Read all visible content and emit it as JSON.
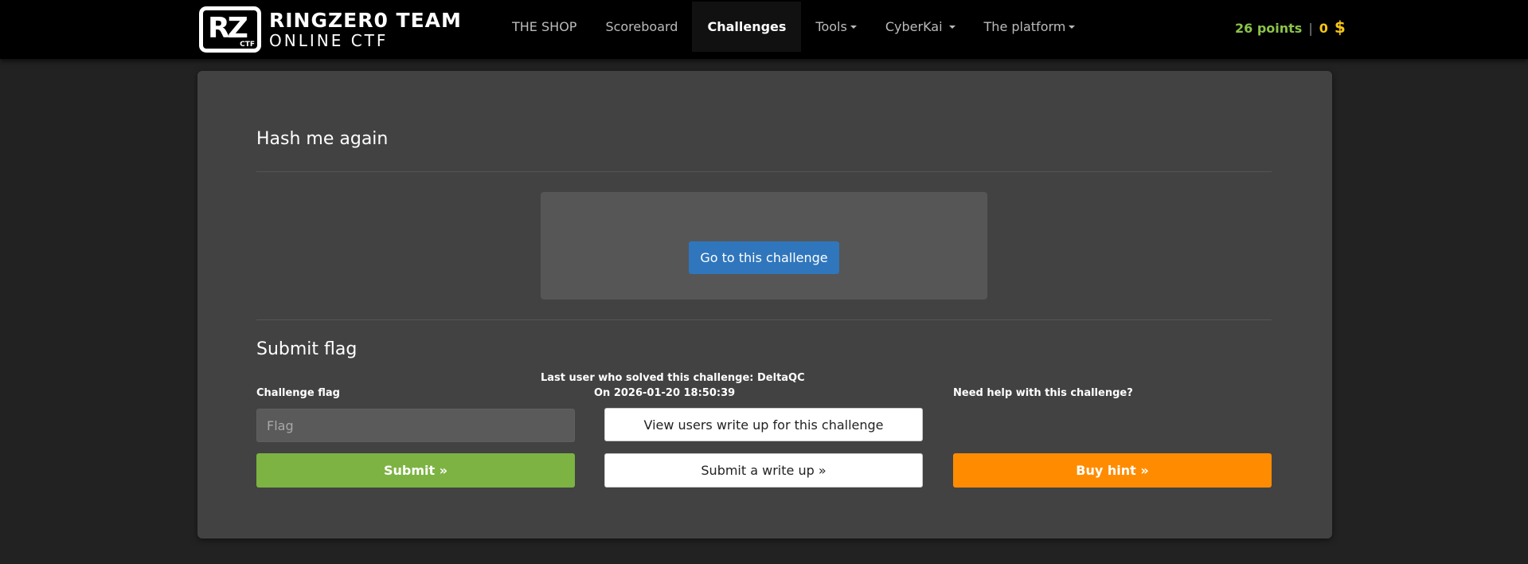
{
  "brand": {
    "logo_text": "RZ",
    "logo_sub": "CTF",
    "line1": "RINGZER0 TEAM",
    "line2": "ONLINE CTF"
  },
  "nav": {
    "shop": "THE SHOP",
    "scoreboard": "Scoreboard",
    "challenges": "Challenges",
    "tools": "Tools",
    "cyberkai": "CyberKai",
    "platform": "The platform"
  },
  "stats": {
    "points": "26 points",
    "separator": "|",
    "coins": "0",
    "currency": "$"
  },
  "challenge": {
    "title": "Hash me again",
    "go_button": "Go to this challenge"
  },
  "submit": {
    "heading": "Submit flag",
    "flag_label": "Challenge flag",
    "flag_placeholder": "Flag",
    "submit_button": "Submit »",
    "last_solved_line1": "Last user who solved this challenge: DeltaQC",
    "last_solved_line2": "On 2026-01-20 18:50:39",
    "writeup_view_button": "View users write up for this challenge",
    "writeup_submit_button": "Submit a write up »",
    "help_label": "Need help with this challenge?",
    "hint_button": "Buy hint »"
  },
  "colors": {
    "accent_blue": "#2f76bd",
    "success_green": "#7cb342",
    "hint_orange": "#ff8c00",
    "points_green": "#8bc34a",
    "coins_gold": "#f5c518"
  }
}
